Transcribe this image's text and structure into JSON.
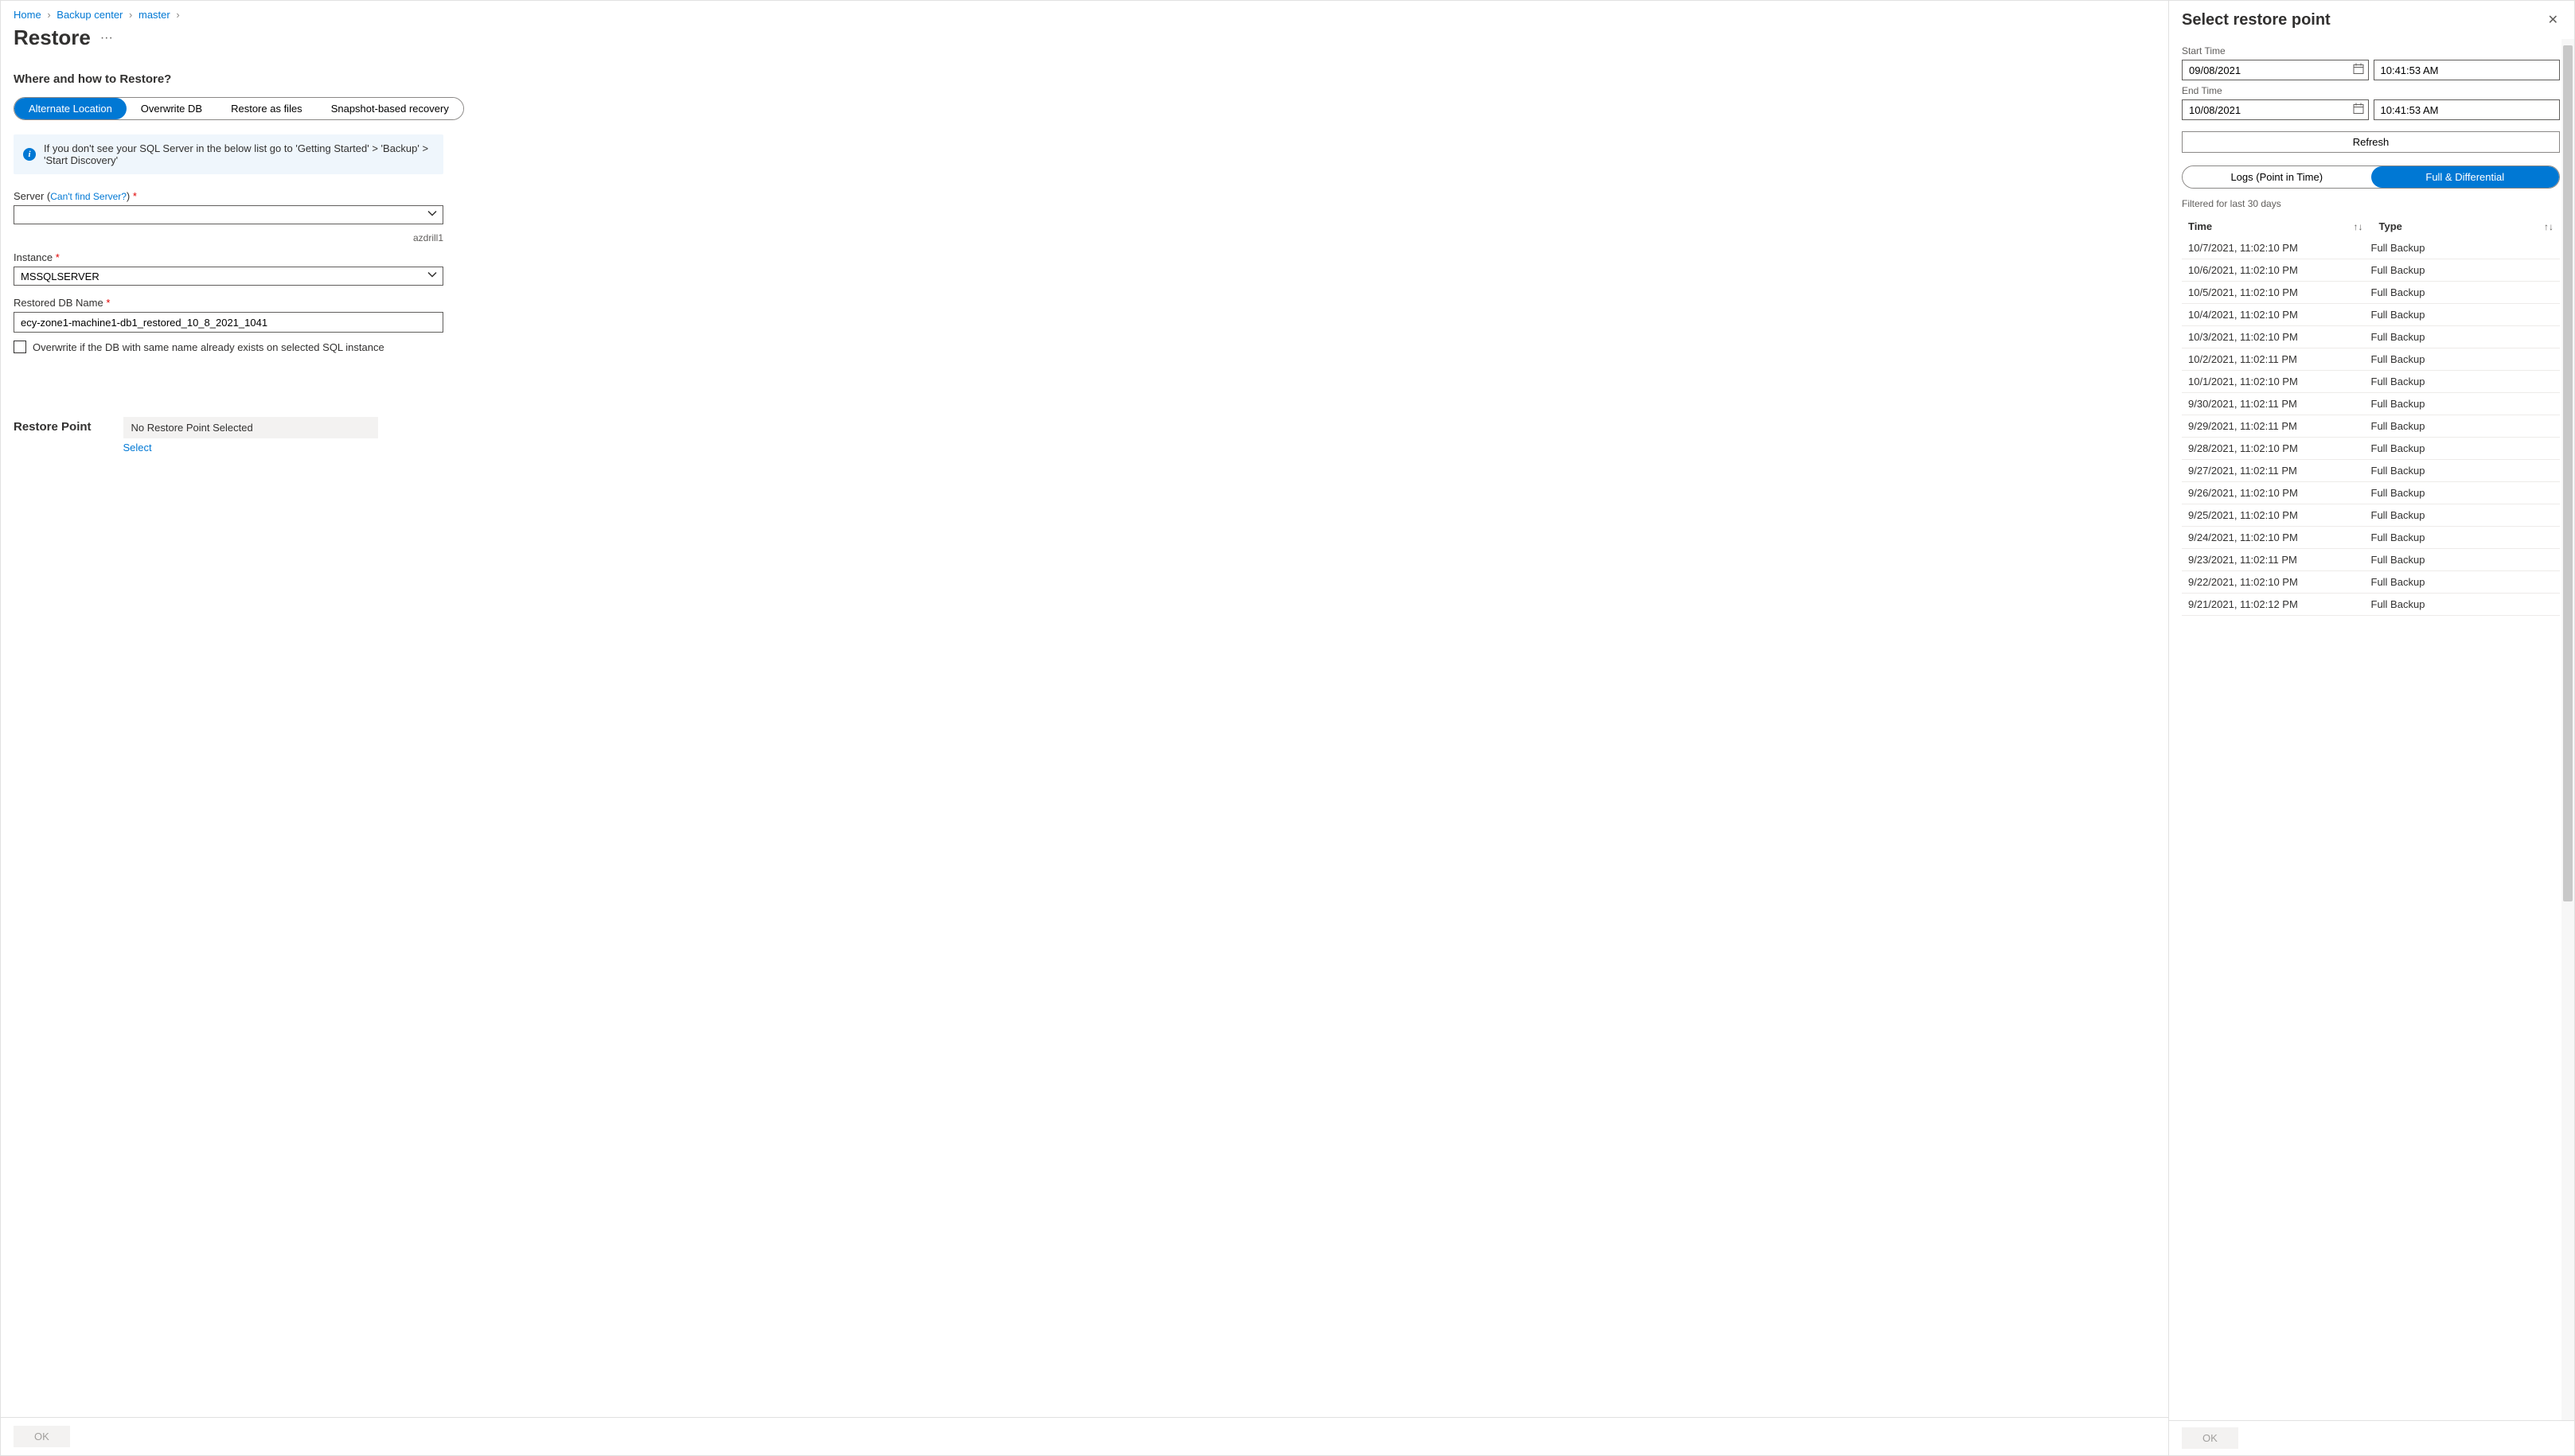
{
  "breadcrumb": {
    "home": "Home",
    "backup_center": "Backup center",
    "master": "master"
  },
  "page_title": "Restore",
  "section_where": "Where and how to Restore?",
  "pills": {
    "alternate": "Alternate Location",
    "overwrite": "Overwrite DB",
    "restore_files": "Restore as files",
    "snapshot": "Snapshot-based recovery"
  },
  "info_text": "If you don't see your SQL Server in the below list go to 'Getting Started' > 'Backup' > 'Start Discovery'",
  "server": {
    "label": "Server",
    "link_text": "Can't find Server?",
    "helper": "azdrill1"
  },
  "instance": {
    "label": "Instance",
    "value": "MSSQLSERVER"
  },
  "restored_db": {
    "label": "Restored DB Name",
    "value": "ecy-zone1-machine1-db1_restored_10_8_2021_1041"
  },
  "overwrite_checkbox": "Overwrite if the DB with same name already exists on selected SQL instance",
  "restore_point": {
    "label": "Restore Point",
    "none": "No Restore Point Selected",
    "select": "Select"
  },
  "footer_ok": "OK",
  "side": {
    "title": "Select restore point",
    "start_time_label": "Start Time",
    "start_date": "09/08/2021",
    "start_time": "10:41:53 AM",
    "end_time_label": "End Time",
    "end_date": "10/08/2021",
    "end_time": "10:41:53 AM",
    "refresh": "Refresh",
    "tab_logs": "Logs (Point in Time)",
    "tab_full": "Full & Differential",
    "filter_text": "Filtered for last 30 days",
    "col_time": "Time",
    "col_type": "Type",
    "rows": [
      {
        "time": "10/7/2021, 11:02:10 PM",
        "type": "Full Backup"
      },
      {
        "time": "10/6/2021, 11:02:10 PM",
        "type": "Full Backup"
      },
      {
        "time": "10/5/2021, 11:02:10 PM",
        "type": "Full Backup"
      },
      {
        "time": "10/4/2021, 11:02:10 PM",
        "type": "Full Backup"
      },
      {
        "time": "10/3/2021, 11:02:10 PM",
        "type": "Full Backup"
      },
      {
        "time": "10/2/2021, 11:02:11 PM",
        "type": "Full Backup"
      },
      {
        "time": "10/1/2021, 11:02:10 PM",
        "type": "Full Backup"
      },
      {
        "time": "9/30/2021, 11:02:11 PM",
        "type": "Full Backup"
      },
      {
        "time": "9/29/2021, 11:02:11 PM",
        "type": "Full Backup"
      },
      {
        "time": "9/28/2021, 11:02:10 PM",
        "type": "Full Backup"
      },
      {
        "time": "9/27/2021, 11:02:11 PM",
        "type": "Full Backup"
      },
      {
        "time": "9/26/2021, 11:02:10 PM",
        "type": "Full Backup"
      },
      {
        "time": "9/25/2021, 11:02:10 PM",
        "type": "Full Backup"
      },
      {
        "time": "9/24/2021, 11:02:10 PM",
        "type": "Full Backup"
      },
      {
        "time": "9/23/2021, 11:02:11 PM",
        "type": "Full Backup"
      },
      {
        "time": "9/22/2021, 11:02:10 PM",
        "type": "Full Backup"
      },
      {
        "time": "9/21/2021, 11:02:12 PM",
        "type": "Full Backup"
      }
    ],
    "ok": "OK"
  }
}
